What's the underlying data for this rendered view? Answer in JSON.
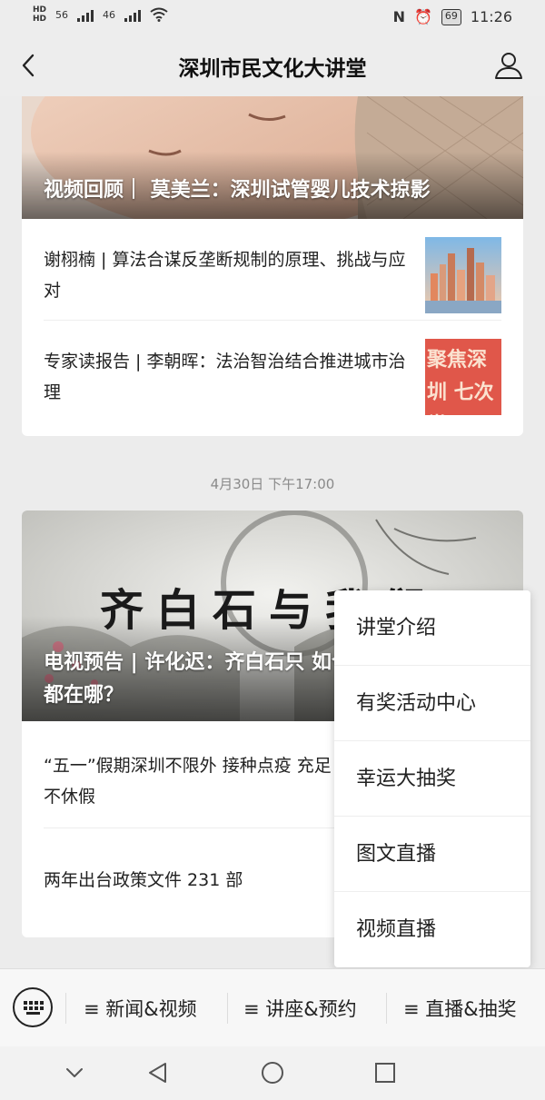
{
  "status_bar": {
    "net1": "56",
    "net2": "46",
    "battery": "69",
    "time": "11:26"
  },
  "header": {
    "title": "深圳市民文化大讲堂"
  },
  "card1": {
    "hero_title": "视频回顾｜ 莫美兰：深圳试管婴儿技术掠影",
    "items": [
      {
        "text": "谢栩楠 | 算法合谋反垄断规制的原理、挑战与应对"
      },
      {
        "text": "专家读报告 | 李朝晖：法治智治结合推进城市治理",
        "thumb_text": "聚焦深圳 七次党"
      }
    ]
  },
  "timestamp": "4月30日 下午17:00",
  "card2": {
    "hero_title": "电视预告 | 许化迟：齐白石只 如今都在哪？",
    "hero_calligraphy": "齐白石与我们",
    "items": [
      {
        "text": "“五一”假期深圳不限外 接种点疫 充足不休假"
      },
      {
        "text": "两年出台政策文件 231 部"
      }
    ]
  },
  "dropdown": {
    "items": [
      "讲堂介绍",
      "有奖活动中心",
      "幸运大抽奖",
      "图文直播",
      "视频直播"
    ]
  },
  "bottom_menu": {
    "items": [
      "≡ 新闻&视频",
      "≡ 讲座&预约",
      "≡ 直播&抽奖"
    ]
  },
  "colors": {
    "background": "#ececec",
    "card": "#ffffff",
    "text": "#222222",
    "muted": "#8a8a8a"
  },
  "icons": [
    "back-icon",
    "user-icon",
    "keyboard-icon",
    "nav-back-icon",
    "nav-home-icon",
    "nav-recents-icon",
    "nav-down-icon",
    "wifi-icon",
    "nfc-icon",
    "alarm-icon"
  ]
}
